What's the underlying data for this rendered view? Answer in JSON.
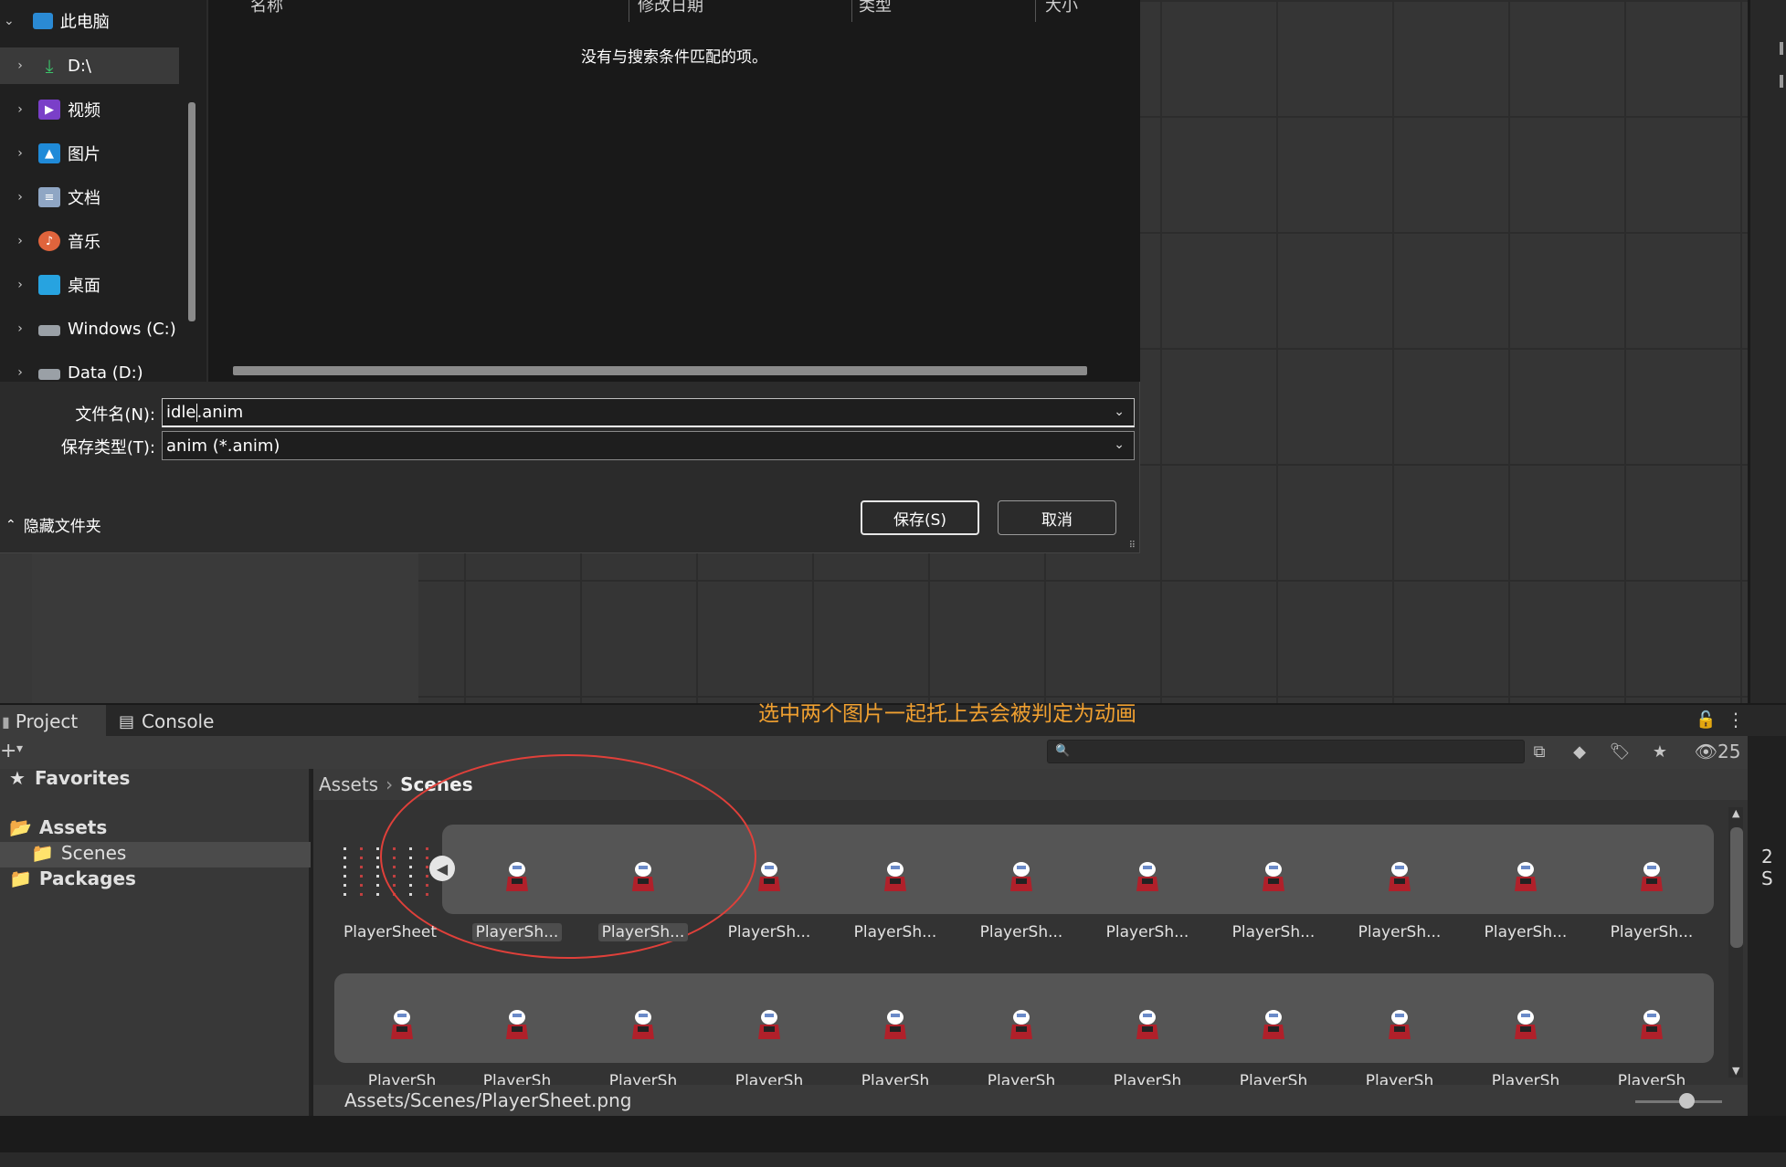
{
  "dialog": {
    "nav_items": [
      {
        "label": "此电脑",
        "icon": "computer-icon"
      },
      {
        "label": "D:\\",
        "icon": "download-arrow-icon"
      },
      {
        "label": "视频",
        "icon": "video-icon"
      },
      {
        "label": "图片",
        "icon": "picture-icon"
      },
      {
        "label": "文档",
        "icon": "document-icon"
      },
      {
        "label": "音乐",
        "icon": "music-icon"
      },
      {
        "label": "桌面",
        "icon": "desktop-icon"
      },
      {
        "label": "Windows (C:)",
        "icon": "drive-icon"
      },
      {
        "label": "Data (D:)",
        "icon": "drive-icon"
      }
    ],
    "columns": [
      "名称",
      "修改日期",
      "类型",
      "大小"
    ],
    "empty_message": "没有与搜索条件匹配的项。",
    "filename_label": "文件名(N):",
    "filename_value_before_caret": "idle",
    "filename_value_after_caret": ".anim",
    "filetype_label": "保存类型(T):",
    "filetype_value": "anim (*.anim)",
    "hide_folders_label": "隐藏文件夹",
    "save_label": "保存(S)",
    "cancel_label": "取消"
  },
  "project": {
    "tabs": [
      "Project",
      "Console"
    ],
    "annotation": "选中两个图片一起托上去会被判定为动画",
    "hidden_count": "25",
    "tree": {
      "favorites": "Favorites",
      "assets": "Assets",
      "scenes": "Scenes",
      "packages": "Packages"
    },
    "breadcrumb": [
      "Assets",
      "Scenes"
    ],
    "row1_labels": [
      "PlayerSheet",
      "PlayerSh...",
      "PlayerSh...",
      "PlayerSh...",
      "PlayerSh...",
      "PlayerSh...",
      "PlayerSh...",
      "PlayerSh...",
      "PlayerSh...",
      "PlayerSh...",
      "PlayerSh..."
    ],
    "row2_labels": [
      "PlayerSh",
      "PlayerSh",
      "PlayerSh",
      "PlayerSh",
      "PlayerSh",
      "PlayerSh",
      "PlayerSh",
      "PlayerSh",
      "PlayerSh",
      "PlayerSh",
      "PlayerSh"
    ],
    "status_path": "Assets/Scenes/PlayerSheet.png",
    "side_label": "2 S"
  },
  "colors": {
    "annotation": "#f0a030",
    "highlight_circle": "#e0403a",
    "sprite_red": "#b0202a",
    "sprite_white": "#ffffff"
  }
}
